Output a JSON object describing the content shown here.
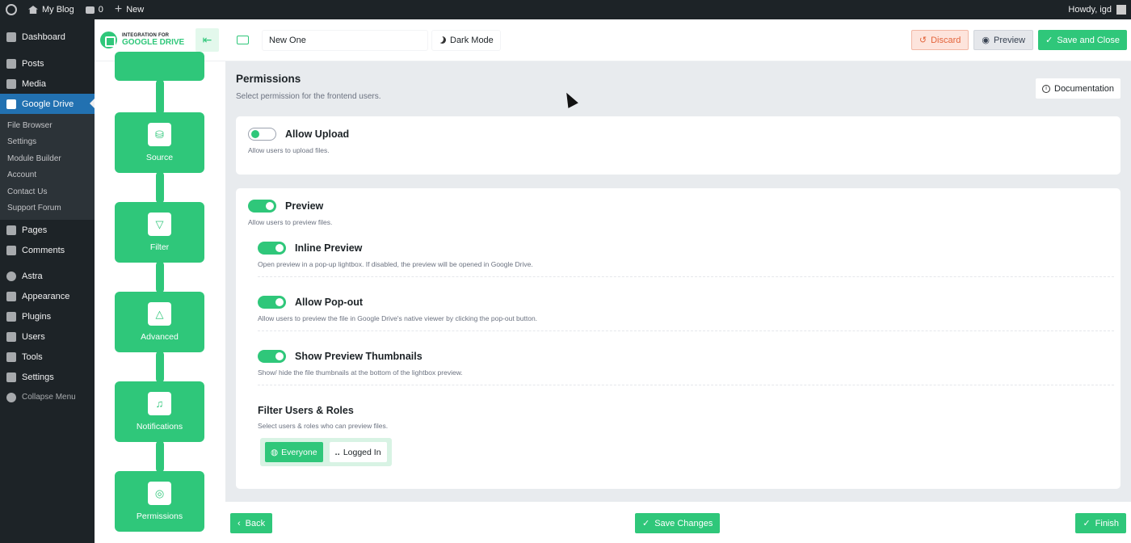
{
  "admin_bar": {
    "site_name": "My Blog",
    "comments_count": "0",
    "new_label": "New",
    "greeting": "Howdy, igd"
  },
  "wp_menu": {
    "items_top": [
      {
        "label": "Dashboard",
        "icon": "dashboard-icon"
      },
      {
        "label": "Posts",
        "icon": "pin-icon"
      },
      {
        "label": "Media",
        "icon": "media-icon"
      },
      {
        "label": "Google Drive",
        "icon": "google-drive-icon",
        "active": true
      }
    ],
    "submenu": [
      "File Browser",
      "Settings",
      "Module Builder",
      "Account",
      "Contact Us",
      "Support Forum"
    ],
    "items_bottom": [
      {
        "label": "Pages",
        "icon": "pages-icon"
      },
      {
        "label": "Comments",
        "icon": "comments-icon"
      },
      {
        "label": "Astra",
        "icon": "astra-icon"
      },
      {
        "label": "Appearance",
        "icon": "brush-icon"
      },
      {
        "label": "Plugins",
        "icon": "plug-icon"
      },
      {
        "label": "Users",
        "icon": "users-icon"
      },
      {
        "label": "Tools",
        "icon": "wrench-icon"
      },
      {
        "label": "Settings",
        "icon": "settings-icon"
      },
      {
        "label": "Collapse Menu",
        "icon": "collapse-icon"
      }
    ]
  },
  "app": {
    "brand_line1": "INTEGRATION FOR",
    "brand_line2": "GOOGLE DRIVE",
    "module_title": "New One",
    "dark_mode_label": "Dark Mode",
    "discard_label": "Discard",
    "preview_label": "Preview",
    "save_close_label": "Save and Close",
    "accent_color": "#2fc77a"
  },
  "steps": [
    {
      "label": "Source",
      "icon": "database-search-icon"
    },
    {
      "label": "Filter",
      "icon": "filter-icon"
    },
    {
      "label": "Advanced",
      "icon": "shapes-icon"
    },
    {
      "label": "Notifications",
      "icon": "bell-icon"
    },
    {
      "label": "Permissions",
      "icon": "eye-settings-icon"
    }
  ],
  "permissions": {
    "title": "Permissions",
    "subtitle": "Select permission for the frontend users.",
    "documentation_label": "Documentation",
    "allow_upload": {
      "label": "Allow Upload",
      "desc": "Allow users to upload files.",
      "enabled": false
    },
    "preview": {
      "label": "Preview",
      "desc": "Allow users to preview files.",
      "enabled": true
    },
    "inline_preview": {
      "label": "Inline Preview",
      "desc": "Open preview in a pop-up lightbox. If disabled, the preview will be opened in Google Drive.",
      "enabled": true
    },
    "allow_popout": {
      "label": "Allow Pop-out",
      "desc": "Allow users to preview the file in Google Drive's native viewer by clicking the pop-out button.",
      "enabled": true
    },
    "show_thumbnails": {
      "label": "Show Preview Thumbnails",
      "desc": "Show/ hide the file thumbnails at the bottom of the lightbox preview.",
      "enabled": true
    },
    "filter_roles": {
      "label": "Filter Users & Roles",
      "desc": "Select users & roles who can preview files.",
      "options": [
        "Everyone",
        "Logged In"
      ],
      "selected": "Everyone"
    }
  },
  "footer": {
    "back_label": "Back",
    "save_changes_label": "Save Changes",
    "finish_label": "Finish"
  }
}
